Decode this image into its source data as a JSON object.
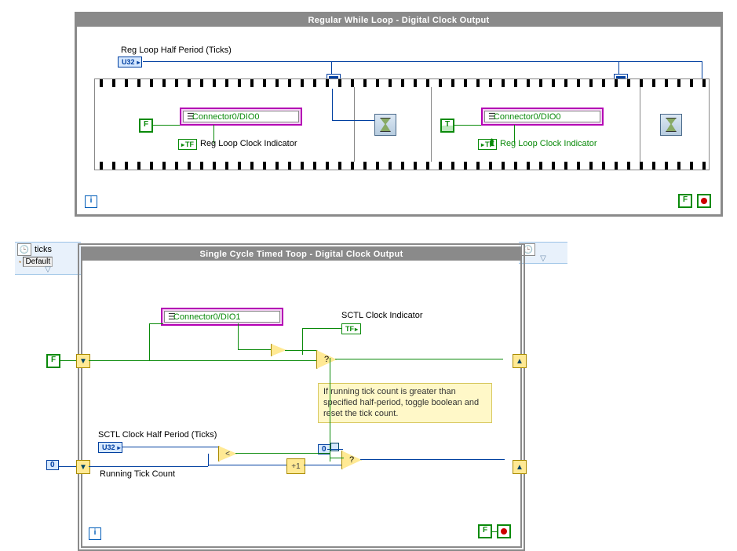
{
  "top": {
    "title": "Regular While Loop - Digital Clock Output",
    "half_period_label": "Reg Loop Half Period (Ticks)",
    "half_period_type": "U32",
    "frame1": {
      "node": "Connector0/DIO0",
      "const": "F",
      "ind_label": "Reg Loop Clock Indicator",
      "ind_type": "TF"
    },
    "frame3": {
      "node": "Connector0/DIO0",
      "const": "T",
      "ind_label": "Reg Loop Clock Indicator",
      "ind_type": "TF"
    },
    "stop_const": "F"
  },
  "bottom": {
    "title": "Single Cycle Timed Toop - Digital Clock Output",
    "left_node_unit": "ticks",
    "left_node_src": "Default",
    "dio": "Connector0/DIO1",
    "ind_label": "SCTL Clock Indicator",
    "ind_type": "TF",
    "hp_label": "SCTL Clock Half Period (Ticks)",
    "hp_type": "U32",
    "running_label": "Running Tick Count",
    "sr_init_upper": "F",
    "sr_init_lower": "0",
    "zero_out": "0",
    "note": "If running tick count is greater than specified half-period, toggle boolean and reset the tick count.",
    "stop_const": "F"
  }
}
